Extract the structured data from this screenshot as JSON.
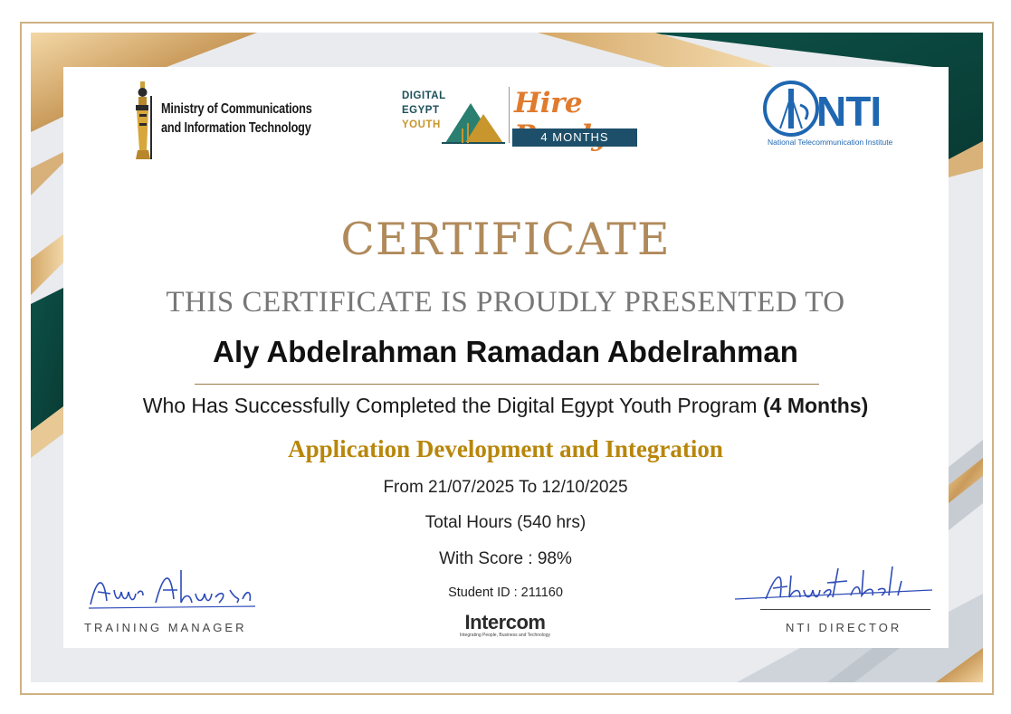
{
  "logos": {
    "mcit": "Ministry of Communications\nand Information Technology",
    "mcit_line1": "Ministry of Communications",
    "mcit_line2": "and Information Technology",
    "dey_line1": "DIGITAL",
    "dey_line2": "EGYPT",
    "dey_line3": "YOUTH",
    "hire_ready": "Hire Ready",
    "months_badge": "4 MONTHS",
    "nti": "NTI",
    "nti_sub": "National Telecommunication Institute",
    "intercom": "Intercom",
    "intercom_tagline": "Integrating People, Business and Technology"
  },
  "certificate": {
    "title": "CERTIFICATE",
    "presented": "THIS CERTIFICATE IS PROUDLY PRESENTED TO",
    "recipient": "Aly Abdelrahman Ramadan Abdelrahman",
    "completed_text": "Who Has Successfully Completed the Digital Egypt Youth Program",
    "duration": "(4 Months)",
    "track": "Application Development and Integration",
    "dates": "From 21/07/2025 To 12/10/2025",
    "hours": "Total Hours (540 hrs)",
    "score": "With Score : 98%",
    "student_id": "Student ID : 211160"
  },
  "signatures": {
    "left_role": "TRAINING MANAGER",
    "left_signature": "Amr Ahmed",
    "right_role": "NTI DIRECTOR"
  },
  "colors": {
    "gold": "#b08a5b",
    "track_gold": "#b8860b",
    "dark_green": "#0f4a43",
    "nti_blue": "#1f67b1",
    "signature_blue": "#2e4bb8"
  }
}
